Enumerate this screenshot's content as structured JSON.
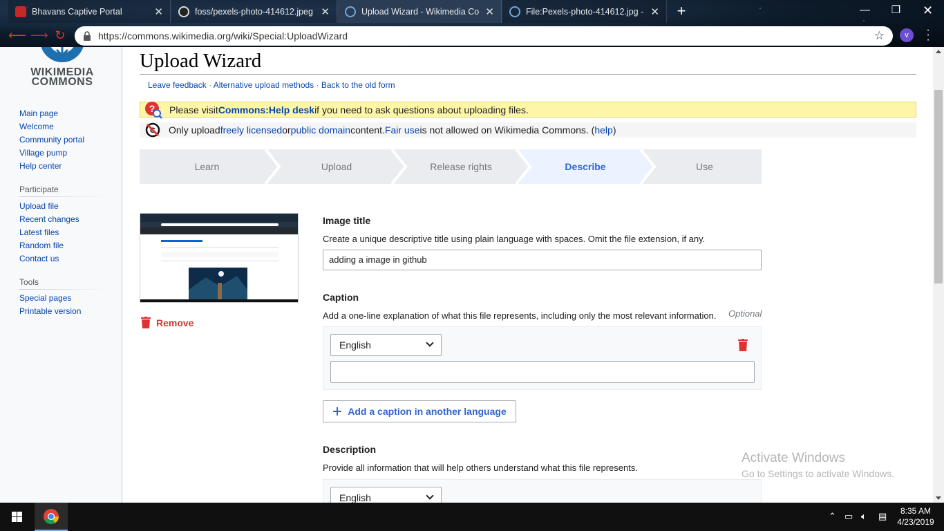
{
  "browser": {
    "tabs": [
      {
        "title": "Bhavans Captive Portal",
        "active": false
      },
      {
        "title": "foss/pexels-photo-414612.jpeg at",
        "active": false
      },
      {
        "title": "Upload Wizard - Wikimedia Com",
        "active": true
      },
      {
        "title": "File:Pexels-photo-414612.jpg - W",
        "active": false
      }
    ],
    "url": "https://commons.wikimedia.org/wiki/Special:UploadWizard",
    "profile_initial": "v"
  },
  "sidebar": {
    "logo_line1": "WIKIMEDIA",
    "logo_line2": "COMMONS",
    "nav": [
      "Main page",
      "Welcome",
      "Community portal",
      "Village pump",
      "Help center"
    ],
    "participate_heading": "Participate",
    "participate": [
      "Upload file",
      "Recent changes",
      "Latest files",
      "Random file",
      "Contact us"
    ],
    "tools_heading": "Tools",
    "tools": [
      "Special pages",
      "Printable version"
    ]
  },
  "page": {
    "title": "Upload Wizard",
    "toplinks": [
      "Leave feedback",
      "Alternative upload methods",
      "Back to the old form"
    ],
    "notice_help": {
      "pre": "Please visit ",
      "link": "Commons:Help desk",
      "post": " if you need to ask questions about uploading files."
    },
    "notice_license": {
      "t1": "Only upload ",
      "l1": "freely licensed",
      "t2": " or ",
      "l2": "public domain",
      "t3": " content. ",
      "l3": "Fair use",
      "t4": " is not allowed on Wikimedia Commons. (",
      "l4": "help",
      "t5": ")"
    },
    "steps": [
      "Learn",
      "Upload",
      "Release rights",
      "Describe",
      "Use"
    ],
    "active_step": "Describe",
    "remove_label": "Remove",
    "image_title": {
      "label": "Image title",
      "help": "Create a unique descriptive title using plain language with spaces. Omit the file extension, if any.",
      "value": "adding a image in github"
    },
    "caption": {
      "label": "Caption",
      "help": "Add a one-line explanation of what this file represents, including only the most relevant information.",
      "optional": "Optional",
      "language": "English",
      "value": "",
      "add_button": "Add a caption in another language"
    },
    "description": {
      "label": "Description",
      "help": "Provide all information that will help others understand what this file represents.",
      "language": "English"
    }
  },
  "watermark": {
    "line1": "Activate Windows",
    "line2": "Go to Settings to activate Windows."
  },
  "taskbar": {
    "time": "8:35 AM",
    "date": "4/23/2019"
  },
  "colors": {
    "link": "#0645ad",
    "accent": "#3366cc",
    "destructive": "#d33333",
    "notice_yellow": "#fef6a7"
  }
}
